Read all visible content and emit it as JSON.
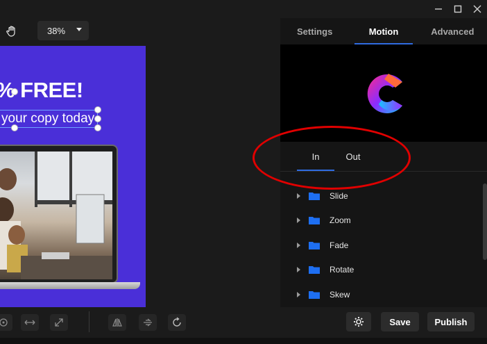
{
  "toolbar": {
    "zoom_value": "38%"
  },
  "canvas": {
    "headline": "% FREE!",
    "subline": "your copy today"
  },
  "panel": {
    "tabs": [
      {
        "label": "Settings",
        "active": false
      },
      {
        "label": "Motion",
        "active": true
      },
      {
        "label": "Advanced",
        "active": false
      }
    ],
    "inout_tabs": [
      {
        "label": "In",
        "active": true
      },
      {
        "label": "Out",
        "active": false
      }
    ],
    "animations": [
      {
        "label": "Slide"
      },
      {
        "label": "Zoom"
      },
      {
        "label": "Fade"
      },
      {
        "label": "Rotate"
      },
      {
        "label": "Skew"
      }
    ]
  },
  "actions": {
    "save_label": "Save",
    "publish_label": "Publish"
  },
  "colors": {
    "canvas_bg": "#4a2fd8",
    "accent": "#2f6be0",
    "annotation": "#e00000",
    "folder": "#1e6ff2"
  },
  "icons": {
    "hand": "hand-icon",
    "settings": "gear-icon",
    "folder": "folder-icon"
  }
}
